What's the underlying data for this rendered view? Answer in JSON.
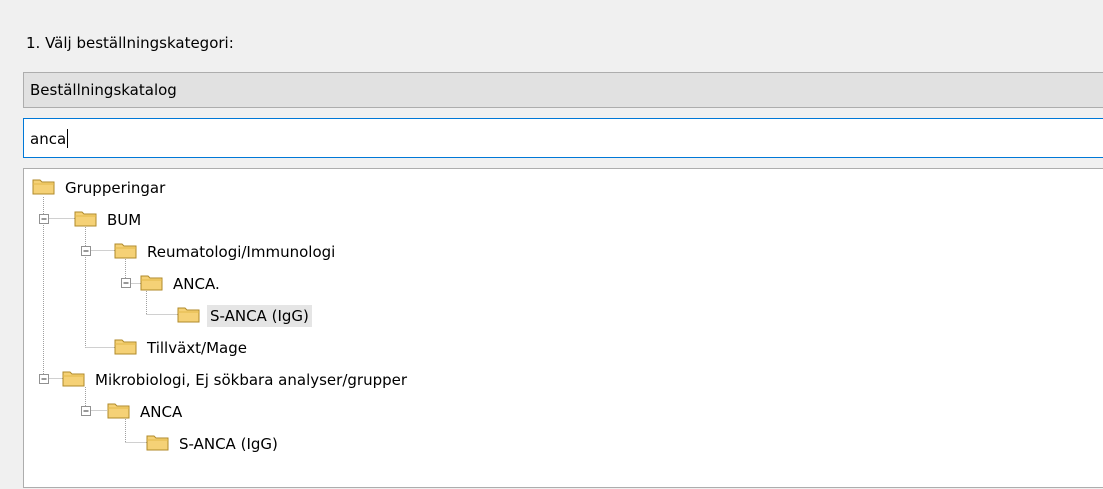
{
  "step": {
    "label": "1. Välj beställningskategori:"
  },
  "category_select": {
    "selected": "Beställningskatalog"
  },
  "search": {
    "value": "anca"
  },
  "tree": {
    "nodes": [
      {
        "label": "Grupperingar"
      },
      {
        "label": "BUM",
        "toggle": "collapse"
      },
      {
        "label": "Reumatologi/Immunologi",
        "toggle": "collapse"
      },
      {
        "label": "ANCA.",
        "toggle": "collapse"
      },
      {
        "label": "S-ANCA (IgG)",
        "selected": true
      },
      {
        "label": "Tillväxt/Mage"
      },
      {
        "label": "Mikrobiologi, Ej sökbara analyser/grupper",
        "toggle": "collapse"
      },
      {
        "label": "ANCA",
        "toggle": "collapse"
      },
      {
        "label": "S-ANCA (IgG)"
      }
    ]
  },
  "colors": {
    "focus_border": "#0078d7",
    "folder_fill": "#f5d176",
    "folder_stroke": "#b08a2a"
  }
}
